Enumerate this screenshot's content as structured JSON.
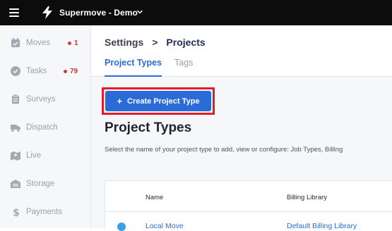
{
  "app": {
    "title": "Supermove - Demo",
    "accent_color": "#2a6bd8",
    "badge_color": "#d33a3f"
  },
  "sidebar": {
    "items": [
      {
        "label": "Moves",
        "icon": "calendar-check-icon",
        "badge": "1"
      },
      {
        "label": "Tasks",
        "icon": "check-circle-icon",
        "badge": "79"
      },
      {
        "label": "Surveys",
        "icon": "clipboard-icon",
        "badge": null
      },
      {
        "label": "Dispatch",
        "icon": "truck-icon",
        "badge": null
      },
      {
        "label": "Live",
        "icon": "map-icon",
        "badge": null
      },
      {
        "label": "Storage",
        "icon": "warehouse-icon",
        "badge": null
      },
      {
        "label": "Payments",
        "icon": "dollar-icon",
        "badge": null
      }
    ]
  },
  "breadcrumb": {
    "parent": "Settings",
    "separator": ">",
    "current": "Projects"
  },
  "tabs": [
    {
      "label": "Project Types",
      "active": true
    },
    {
      "label": "Tags",
      "active": false
    }
  ],
  "main": {
    "create_button_label": "Create Project Type",
    "create_button_icon": "+",
    "section_title": "Project Types",
    "section_description": "Select the name of your project type to add, view or configure: Job Types, Billing"
  },
  "table": {
    "columns": [
      "Name",
      "Billing Library"
    ],
    "rows": [
      {
        "color": "#3aa0e2",
        "name": "Local Move",
        "billing_library": "Default Billing Library"
      }
    ]
  }
}
